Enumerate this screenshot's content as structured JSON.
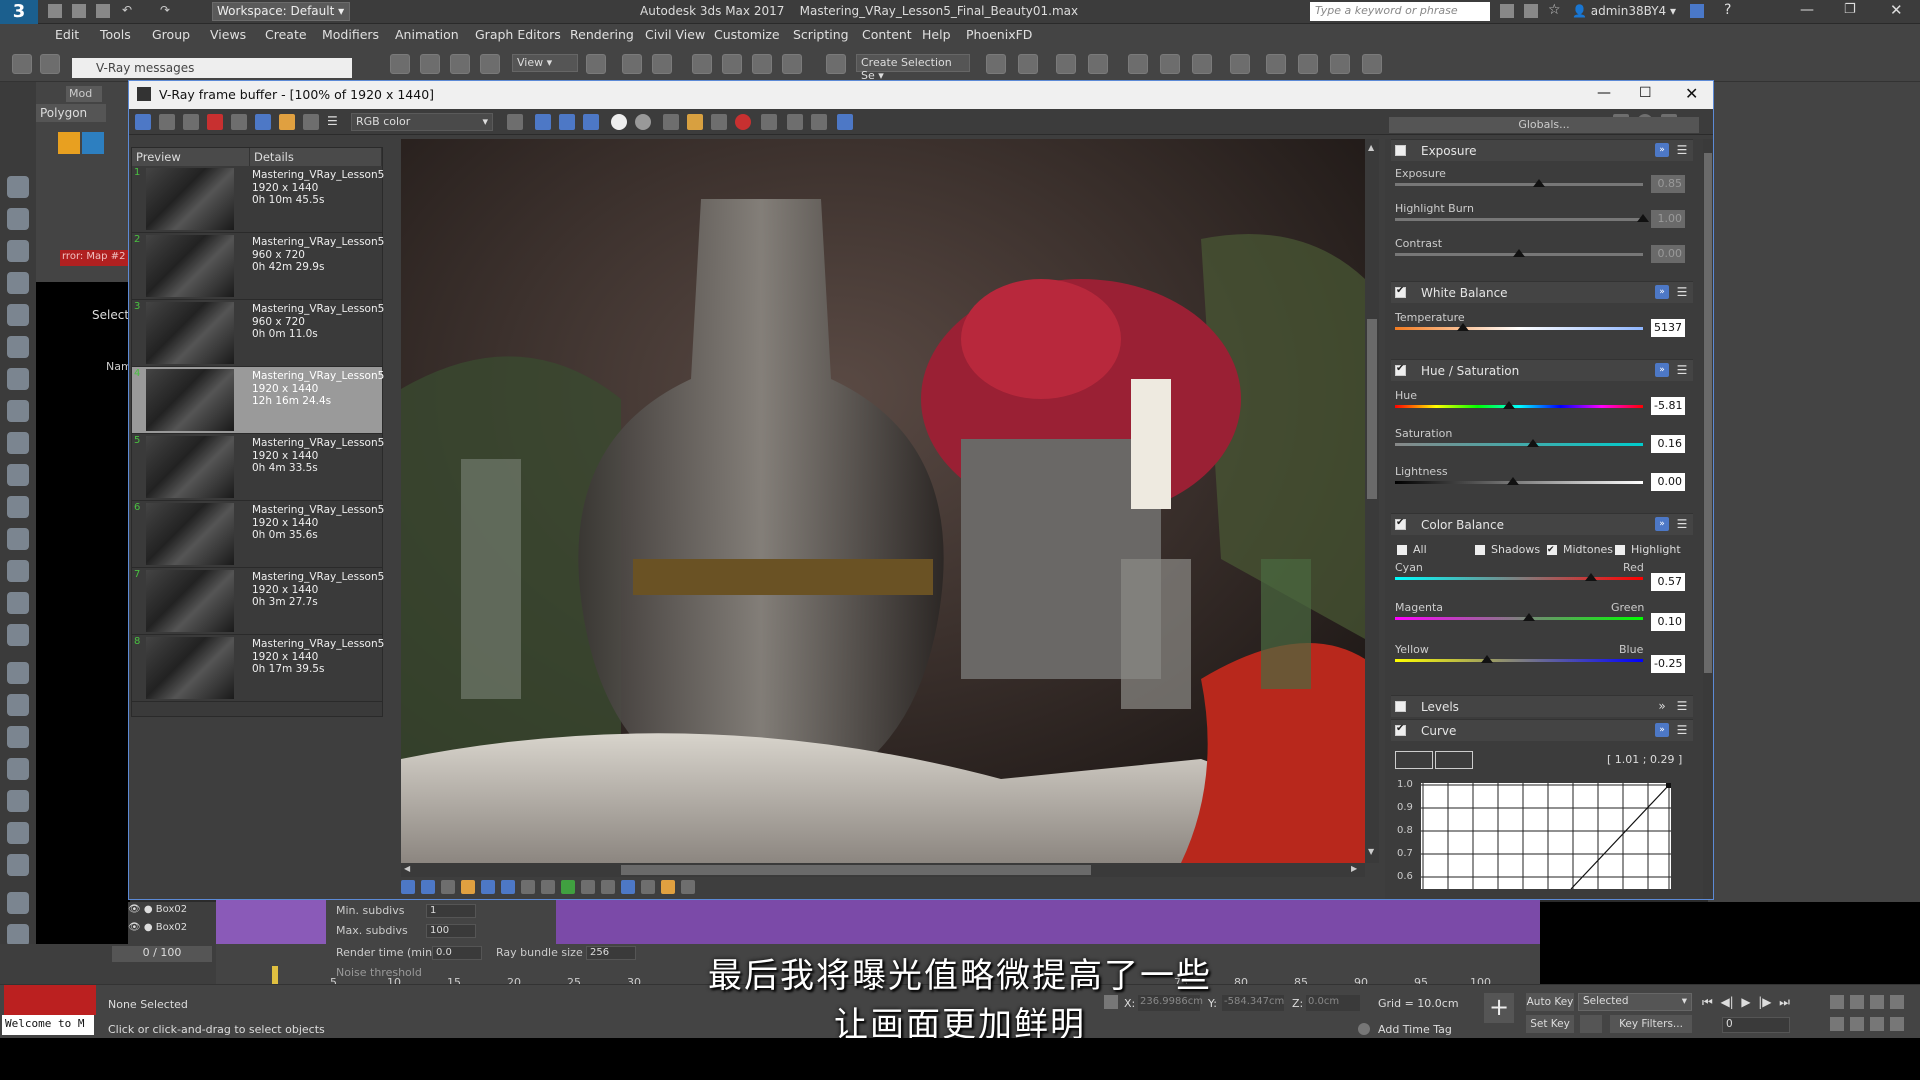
{
  "app": {
    "title": "Autodesk 3ds Max 2017",
    "file": "Mastering_VRay_Lesson5_Final_Beauty01.max",
    "workspace": "Workspace: Default",
    "search_placeholder": "Type a keyword or phrase",
    "user": "admin38BY4"
  },
  "menu": [
    "Edit",
    "Tools",
    "Group",
    "Views",
    "Create",
    "Modifiers",
    "Animation",
    "Graph Editors",
    "Rendering",
    "Civil View",
    "Customize",
    "Scripting",
    "Content",
    "Help",
    "PhoenixFD"
  ],
  "toolbar": {
    "view_dropdown": "View",
    "selection_set": "Create Selection Se"
  },
  "vray_messages": {
    "title": "V-Ray messages"
  },
  "left_panel": {
    "mod_tab": "Mod",
    "polygon": "Polygon",
    "select": "Select",
    "name": "Nam",
    "error_text": "rror: Map #2"
  },
  "vfb": {
    "title": "V-Ray frame buffer - [100% of 1920 x 1440]",
    "channel": "RGB color",
    "globals": "Globals...",
    "history_headers": {
      "preview": "Preview",
      "details": "Details"
    },
    "history": [
      {
        "num": "1",
        "name": "Mastering_VRay_Lesson5",
        "res": "1920 x 1440",
        "time": "0h 10m 45.5s"
      },
      {
        "num": "2",
        "name": "Mastering_VRay_Lesson5",
        "res": "960 x 720",
        "time": "0h 42m 29.9s"
      },
      {
        "num": "3",
        "name": "Mastering_VRay_Lesson5",
        "res": "960 x 720",
        "time": "0h 0m 11.0s"
      },
      {
        "num": "4",
        "name": "Mastering_VRay_Lesson5",
        "res": "1920 x 1440",
        "time": "12h 16m 24.4s",
        "selected": true
      },
      {
        "num": "5",
        "name": "Mastering_VRay_Lesson5",
        "res": "1920 x 1440",
        "time": "0h 4m 33.5s"
      },
      {
        "num": "6",
        "name": "Mastering_VRay_Lesson5",
        "res": "1920 x 1440",
        "time": "0h 0m 35.6s"
      },
      {
        "num": "7",
        "name": "Mastering_VRay_Lesson5",
        "res": "1920 x 1440",
        "time": "0h 3m 27.7s"
      },
      {
        "num": "8",
        "name": "Mastering_VRay_Lesson5",
        "res": "1920 x 1440",
        "time": "0h 17m 39.5s"
      }
    ]
  },
  "color_corrections": {
    "exposure": {
      "title": "Exposure",
      "exposure_label": "Exposure",
      "exposure_value": "0.85",
      "highlight_label": "Highlight Burn",
      "highlight_value": "1.00",
      "contrast_label": "Contrast",
      "contrast_value": "0.00"
    },
    "white_balance": {
      "title": "White Balance",
      "temperature_label": "Temperature",
      "temperature_value": "5137"
    },
    "hue_sat": {
      "title": "Hue / Saturation",
      "hue_label": "Hue",
      "hue_value": "-5.81",
      "sat_label": "Saturation",
      "sat_value": "0.16",
      "light_label": "Lightness",
      "light_value": "0.00"
    },
    "color_balance": {
      "title": "Color Balance",
      "all": "All",
      "shadows": "Shadows",
      "midtones": "Midtones",
      "highlight": "Highlight",
      "cyan": "Cyan",
      "red": "Red",
      "cr_value": "0.57",
      "magenta": "Magenta",
      "green": "Green",
      "mg_value": "0.10",
      "yellow": "Yellow",
      "blue": "Blue",
      "yb_value": "-0.25"
    },
    "levels": {
      "title": "Levels"
    },
    "curve": {
      "title": "Curve",
      "coords": "[ 1.01 ; 0.29 ]",
      "y_ticks": [
        "1.0",
        "0.9",
        "0.8",
        "0.7",
        "0.6"
      ]
    }
  },
  "scene": {
    "objects": [
      "Box02",
      "Box02"
    ],
    "frame": "0 / 100"
  },
  "render_params": {
    "min_subdivs_label": "Min. subdivs",
    "min_subdivs": "1",
    "max_subdivs_label": "Max. subdivs",
    "max_subdivs": "100",
    "render_time_label": "Render time (min)",
    "render_time": "0.0",
    "ray_bundle_label": "Ray bundle size",
    "ray_bundle": "256",
    "noise_label": "Noise threshold"
  },
  "timeline_ticks": [
    "5",
    "10",
    "15",
    "20",
    "25",
    "30",
    "75",
    "80",
    "85",
    "90",
    "95",
    "100"
  ],
  "status": {
    "selection": "None Selected",
    "prompt": "Click or click-and-drag to select objects",
    "welcome": "Welcome to M",
    "x_label": "X:",
    "x_value": "236.9986cm",
    "y_label": "Y:",
    "y_value": "-584.347cm",
    "z_label": "Z:",
    "z_value": "0.0cm",
    "grid": "Grid = 10.0cm",
    "add_time_tag": "Add Time Tag",
    "auto_key": "Auto Key",
    "selected_dropdown": "Selected",
    "set_key": "Set Key",
    "key_filters": "Key Filters...",
    "frame_field": "0"
  },
  "subtitles": {
    "line1": "最后我将曝光值略微提高了一些",
    "line2": "让画面更加鲜明"
  }
}
